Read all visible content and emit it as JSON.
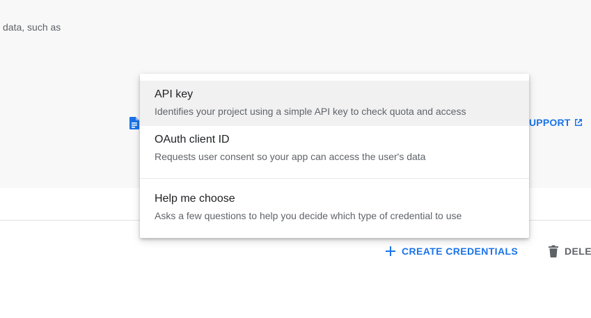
{
  "background": {
    "intro_text": "data, such as",
    "support_link_label": "UPPORT"
  },
  "menu": {
    "items": [
      {
        "title": "API key",
        "description": "Identifies your project using a simple API key to check quota and access"
      },
      {
        "title": "OAuth client ID",
        "description": "Requests user consent so your app can access the user's data"
      },
      {
        "title": "Help me choose",
        "description": "Asks a few questions to help you decide which type of credential to use"
      }
    ]
  },
  "toolbar": {
    "create_label": "CREATE CREDENTIALS",
    "delete_label": "DELE"
  },
  "colors": {
    "accent": "#1a73e8",
    "panel_bg": "#f8f8f8",
    "muted_text": "#5f6368",
    "hover_bg": "#f1f1f1"
  },
  "icons": {
    "doc": "document-icon",
    "external": "open-in-new-icon",
    "add": "plus-icon",
    "delete": "trash-icon"
  }
}
